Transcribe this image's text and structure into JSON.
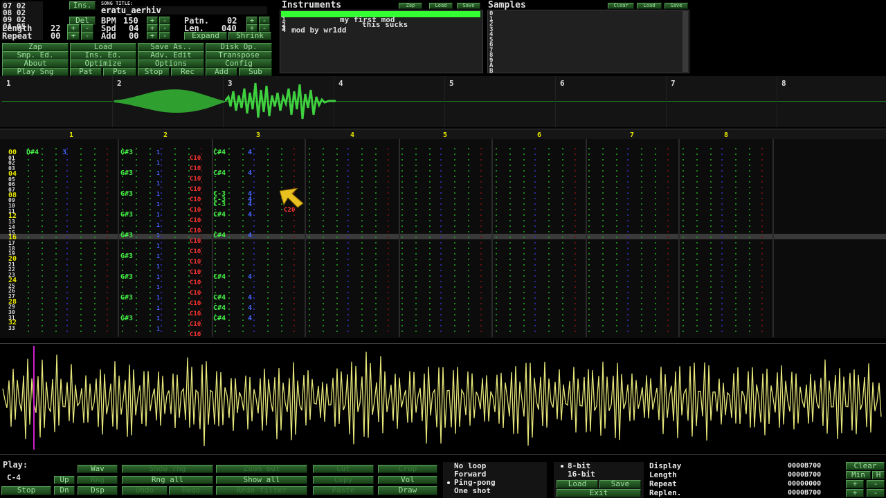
{
  "song": {
    "pos_list": [
      "07 02",
      "08 02",
      "09 02",
      "0A 05"
    ],
    "title_header": "SONG TITLE:",
    "title": "eratu_aerhiv",
    "length_label": "Length",
    "length_value": "22",
    "repeat_label": "Repeat",
    "repeat_value": "00",
    "bpm_label": "BPM",
    "bpm_value": "150",
    "spd_label": "Spd",
    "spd_value": "04",
    "add_label": "Add",
    "add_value": "00",
    "patn_label": "Patn.",
    "patn_value": "02",
    "len_label": "Len.",
    "len_value": "040",
    "ins_label": "Ins.",
    "del_label": "Del"
  },
  "toolbar": {
    "expand_label": "Expand",
    "shrink_label": "Shrink",
    "buttons": [
      [
        "Zap",
        "Load",
        "Save As..",
        "Disk Op."
      ],
      [
        "Smp. Ed.",
        "Ins. Ed.",
        "Adv. Edit",
        "Transpose"
      ],
      [
        "About",
        "Optimize",
        "Options",
        "Config"
      ],
      [
        "Play Sng",
        "Pat",
        "Pos",
        "Stop",
        "Rec",
        "Add",
        "Sub"
      ]
    ]
  },
  "instruments": {
    "header": "Instruments",
    "items": [
      "my first mod",
      "this sucks",
      "",
      "mod by wr1dd"
    ],
    "numbers": [
      "1",
      "2",
      "3",
      "4"
    ],
    "zap": "Zap",
    "load": "Load",
    "save": "Save"
  },
  "samples": {
    "header": "Samples",
    "numbers": [
      "0",
      "1",
      "2",
      "3",
      "4",
      "5",
      "6",
      "7",
      "8",
      "9",
      "A",
      "B"
    ],
    "clear": "Clear",
    "load": "Load",
    "save": "Save"
  },
  "scopes": [
    "1",
    "2",
    "3",
    "4",
    "5",
    "6",
    "7",
    "8"
  ],
  "channels": [
    "1",
    "2",
    "3",
    "4",
    "5",
    "6",
    "7",
    "8"
  ],
  "pattern": {
    "rows": [
      "00",
      "01",
      "02",
      "03",
      "04",
      "05",
      "06",
      "07",
      "08",
      "09",
      "10",
      "11",
      "12",
      "13",
      "14",
      "15",
      "16",
      "17",
      "18",
      "19",
      "20",
      "21",
      "22",
      "23",
      "24",
      "25",
      "26",
      "27",
      "28",
      "29",
      "30",
      "31",
      "32",
      "33"
    ],
    "ch1_first_note": "D#4",
    "ch1_first_ins": "3",
    "ch2_notes": [
      "G#3",
      "G#3",
      "G#3",
      "G#3",
      "G#3",
      "G#3",
      "G#3",
      "G#3",
      "G#3"
    ],
    "ch2_ins": "1",
    "ch2_vol": "C10",
    "ch3_notes": [
      "C#4",
      "C#4",
      "C-3",
      "C-3",
      "C-3",
      "C#4",
      "C#4",
      "C#4",
      "C#4",
      "C#4",
      "C#4"
    ],
    "ch3_ins": "4",
    "ch4_vol": "C20"
  },
  "sample_editor": {
    "play_label": "Play:",
    "note": "C-4",
    "stop": "Stop",
    "up": "Up",
    "dn": "Dn",
    "wav": "Wav",
    "rng": "Rng",
    "dsp": "Dsp",
    "show_rng": "Show rng",
    "rng_all": "Rng all",
    "undo": "Undo",
    "zoom_out": "Zoom out",
    "show_all": "Show all",
    "redo": "Redo",
    "redo_filter": "Redo filter",
    "cut": "Cut",
    "copy": "Copy",
    "paste": "Paste",
    "crop": "Crop",
    "vol": "Vol",
    "draw": "Draw",
    "loop_opts": [
      "No loop",
      "Forward",
      "Ping-pong",
      "One shot"
    ],
    "bit_opts": [
      "8-bit",
      "16-bit"
    ],
    "load": "Load",
    "save": "Save",
    "exit": "Exit",
    "display_label": "Display",
    "length_label": "Length",
    "repeat_label": "Repeat",
    "replen_label": "Replen.",
    "display_value": "0000B700",
    "length_value": "0000B700",
    "repeat_value": "00000000",
    "replen_value": "0000B700",
    "clear": "Clear",
    "min": "Min",
    "h": "H"
  },
  "colors": {
    "accent": "#33ff33",
    "wave": "#e6e67a",
    "note_green": "#44ee44",
    "vol_red": "#ff3333",
    "ins_blue": "#4466ff",
    "row_yellow": "#e6e600"
  }
}
